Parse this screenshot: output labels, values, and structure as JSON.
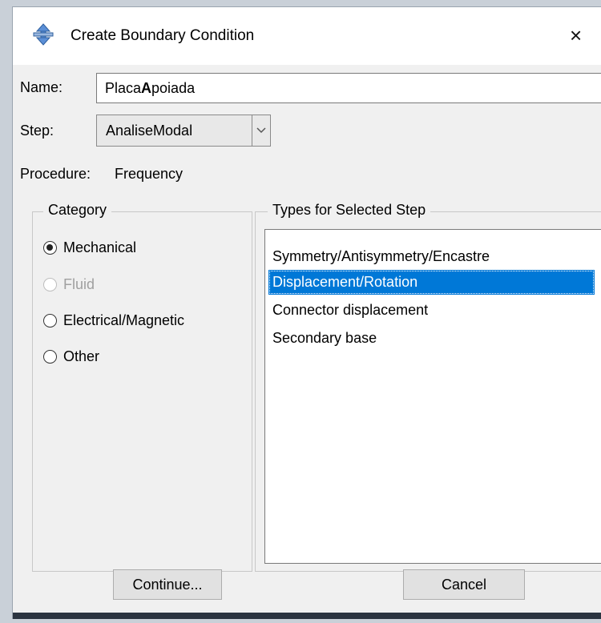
{
  "dialog": {
    "title": "Create Boundary Condition",
    "close_glyph": "×",
    "icon": "boundary-condition-icon"
  },
  "name": {
    "label": "Name:",
    "value_part1": "Placa",
    "value_part2_bold": "A",
    "value_part3": "poiada"
  },
  "step": {
    "label": "Step:",
    "selected": "AnaliseModal"
  },
  "procedure": {
    "label": "Procedure:",
    "value": "Frequency"
  },
  "category": {
    "title": "Category",
    "options": [
      {
        "label": "Mechanical",
        "checked": true,
        "disabled": false
      },
      {
        "label": "Fluid",
        "checked": false,
        "disabled": true
      },
      {
        "label": "Electrical/Magnetic",
        "checked": false,
        "disabled": false
      },
      {
        "label": "Other",
        "checked": false,
        "disabled": false
      }
    ]
  },
  "types": {
    "title": "Types for Selected Step",
    "items": [
      "Symmetry/Antisymmetry/Encastre",
      "Displacement/Rotation",
      "Connector displacement",
      "Secondary base"
    ],
    "selected_index": 1
  },
  "buttons": {
    "continue": "Continue...",
    "cancel": "Cancel"
  },
  "colors": {
    "selection": "#0078d7",
    "icon_blue": "#4a7cc0",
    "window_bg": "#f0f0f0"
  }
}
